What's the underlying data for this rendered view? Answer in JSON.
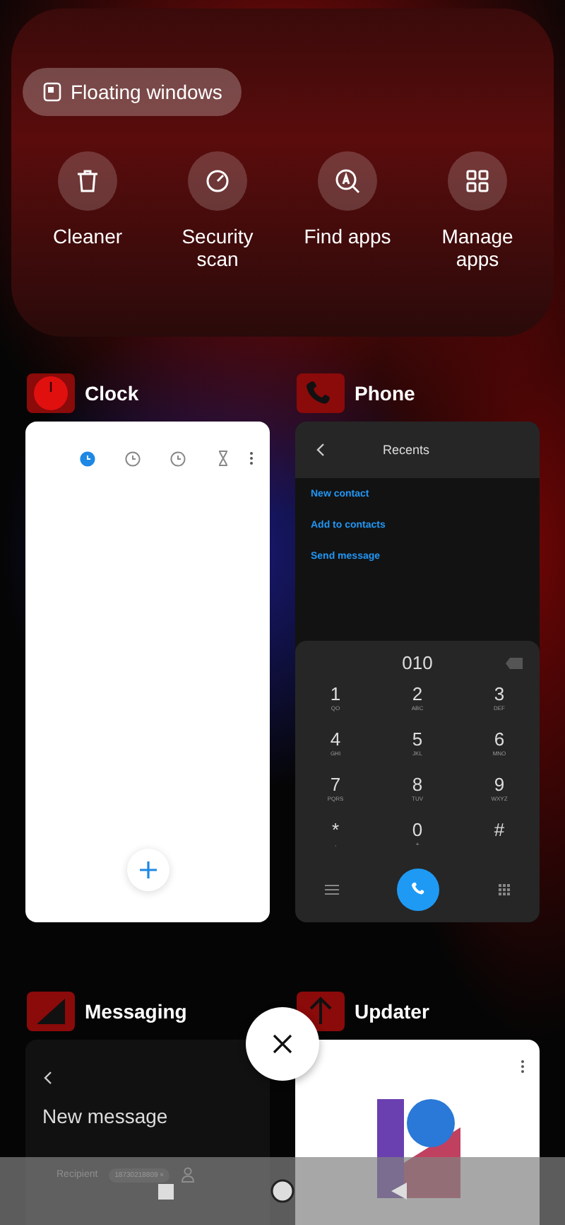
{
  "quick_bar": {
    "floating_windows": "Floating windows",
    "actions": [
      {
        "kind": "cleaner",
        "label": "Cleaner"
      },
      {
        "kind": "security",
        "label": "Security scan"
      },
      {
        "kind": "find",
        "label": "Find apps"
      },
      {
        "kind": "manage",
        "label": "Manage apps"
      }
    ]
  },
  "apps": [
    {
      "kind": "clock",
      "name": "Clock",
      "tabs": [
        {
          "kind": "alarm",
          "selected": true
        },
        {
          "kind": "world",
          "selected": false
        },
        {
          "kind": "stopwatch",
          "selected": false
        },
        {
          "kind": "timer",
          "selected": false
        }
      ]
    },
    {
      "kind": "phone",
      "name": "Phone",
      "title": "Recents",
      "links": [
        "New contact",
        "Add to contacts",
        "Send message"
      ],
      "number": "010",
      "keys": [
        {
          "digit": "1",
          "letters": "QO"
        },
        {
          "digit": "2",
          "letters": "ABC"
        },
        {
          "digit": "3",
          "letters": "DEF"
        },
        {
          "digit": "4",
          "letters": "GHI"
        },
        {
          "digit": "5",
          "letters": "JKL"
        },
        {
          "digit": "6",
          "letters": "MNO"
        },
        {
          "digit": "7",
          "letters": "PQRS"
        },
        {
          "digit": "8",
          "letters": "TUV"
        },
        {
          "digit": "9",
          "letters": "WXYZ"
        },
        {
          "digit": "*",
          "letters": ","
        },
        {
          "digit": "0",
          "letters": "+"
        },
        {
          "digit": "#"
        }
      ]
    },
    {
      "kind": "messaging",
      "name": "Messaging",
      "title": "New message",
      "recipient_label": "Recipient",
      "recipient": "18730218809 ×"
    },
    {
      "kind": "updater",
      "name": "Updater"
    }
  ]
}
